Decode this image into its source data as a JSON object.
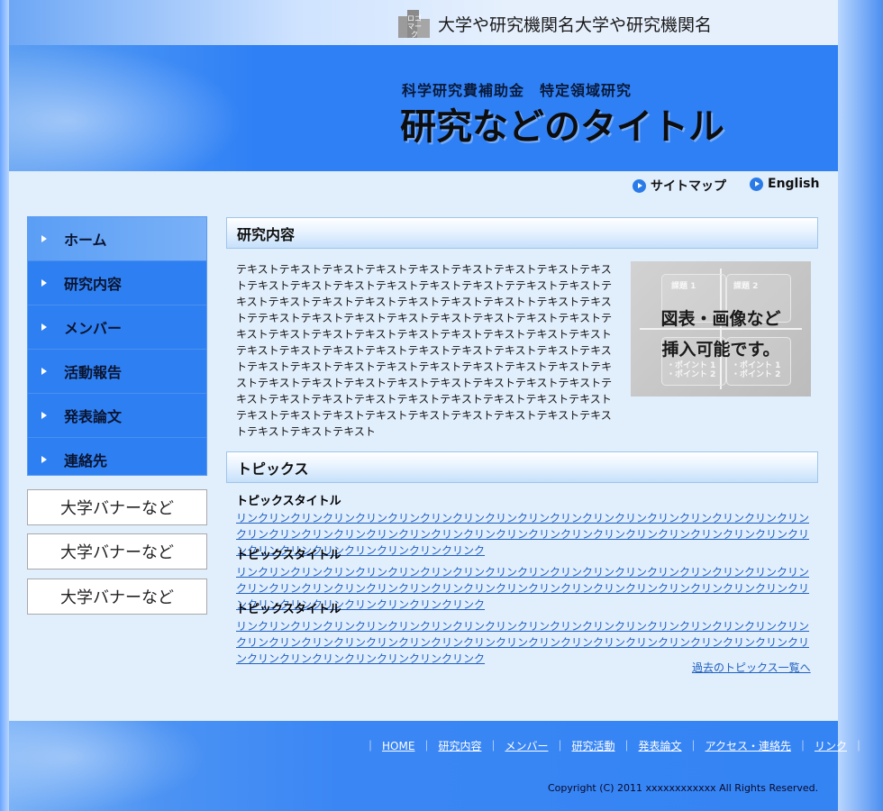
{
  "colors": {
    "accent_blue": "#2f80f5",
    "content_bg": "#e1eefc",
    "link": "#2060c0"
  },
  "top": {
    "logo_text": "ロゴ\nマーク",
    "institution": "大学や研究機関名大学や研究機関名"
  },
  "header": {
    "subtitle": "科学研究費補助金　特定領域研究",
    "title": "研究などのタイトル"
  },
  "util_links": {
    "sitemap": "サイトマップ",
    "english": "English",
    "icon": "circle-arrow-icon"
  },
  "nav": {
    "items": [
      {
        "label": "ホーム"
      },
      {
        "label": "研究内容"
      },
      {
        "label": "メンバー"
      },
      {
        "label": "活動報告"
      },
      {
        "label": "発表論文"
      },
      {
        "label": "連絡先"
      }
    ]
  },
  "banners": [
    "大学バナーなど",
    "大学バナーなど",
    "大学バナーなど"
  ],
  "research": {
    "heading": "研究内容",
    "text": "テキストテキストテキストテキストテキストテキストテキストテキストテキストテキストテキストテキストテキストテキストテキストテテキストテキストテキストテキストテキストテキストテキストテキストテキストトテキストテキストテテキストテキストテキストテキストテキストテキストテキストテキストテキストテキストテキストテキストテキストテキストテキストテキストテキストテキストテキストテキストテキストテキストテキストテキストテキストテキストテキストテキストテキストテキストテキストテキストテキストテキストテキストテキストテキストテキストテキストテキストテキストテキストテキストテキストテキストテキストテキストテキストテキストテキストテキストテキストテキストテキストテキストテキストテキストテキストテキストテキストテキストテキストテキストテキスト",
    "figure": {
      "box1_title": "課題 1",
      "box2_title": "課題 2",
      "point1": "・ポイント 1",
      "point2": "・ポイント 2",
      "caption_line1": "図表・画像など",
      "caption_line2": "挿入可能です。"
    }
  },
  "topics": {
    "heading": "トピックス",
    "items": [
      {
        "title": "トピックスタイトル",
        "link": "リンクリンクリンクリンクリンクリンクリンクリンクリンクリンクリンクリンクリンクリンクリンクリンクリンクリンクリンクリンクリンクリンクリンクリンクリンクリンクリンクリンクリンクリンクリンクリンクリンクリンクリンクリンクリンクリンクリンクリンクリンクリンクリンク"
      },
      {
        "title": "トピックスタイトル",
        "link": "リンクリンクリンクリンクリンクリンクリンクリンクリンクリンクリンクリンクリンクリンクリンクリンクリンクリンクリンクリンクリンクリンクリンクリンクリンクリンクリンクリンクリンクリンクリンクリンクリンクリンクリンクリンクリンクリンクリンクリンクリンクリンクリンク"
      },
      {
        "title": "トピックスタイトル",
        "link": "リンクリンクリンクリンクリンクリンクリンクリンクリンクリンクリンクリンクリンクリンクリンクリンクリンクリンクリンクリンクリンクリンクリンクリンクリンクリンクリンクリンクリンクリンクリンクリンクリンクリンクリンクリンクリンクリンクリンクリンクリンクリンクリンク"
      }
    ],
    "past_link": "過去のトピックス一覧へ"
  },
  "footer": {
    "links": [
      "HOME",
      "研究内容",
      "メンバー",
      "研究活動",
      "発表論文",
      "アクセス・連絡先",
      "リンク"
    ],
    "separator": "｜",
    "copyright": "Copyright (C) 2011 xxxxxxxxxxxx All Rights Reserved."
  }
}
